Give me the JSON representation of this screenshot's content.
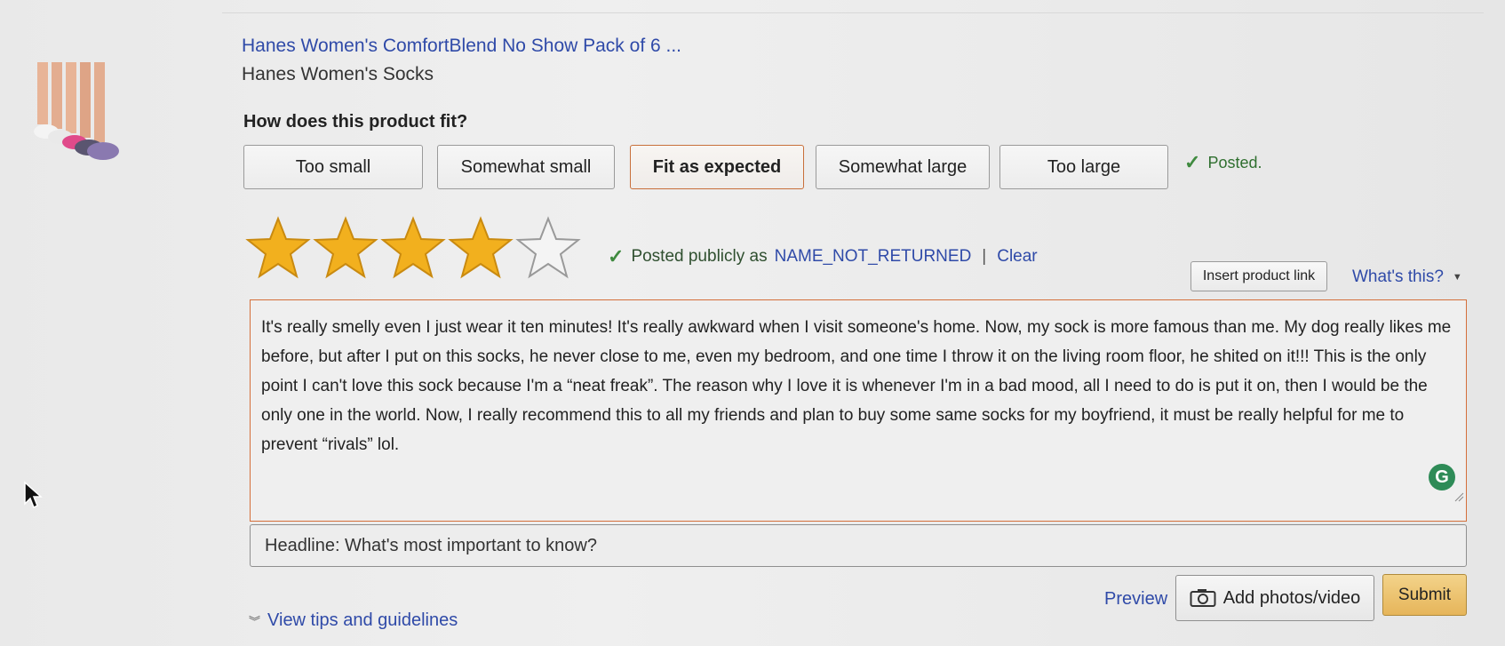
{
  "product": {
    "title": "Hanes Women's ComfortBlend No Show Pack of 6 ...",
    "subtitle": "Hanes Women's Socks"
  },
  "fit": {
    "question": "How does this product fit?",
    "options": [
      "Too small",
      "Somewhat small",
      "Fit as expected",
      "Somewhat large",
      "Too large"
    ],
    "selected": "Fit as expected",
    "status": "Posted."
  },
  "rating": {
    "value": 4,
    "max": 5,
    "star_color": "#f2b01e",
    "posted_prefix": "Posted publicly as",
    "posted_name": "NAME_NOT_RETURNED",
    "separator": "|",
    "clear_label": "Clear"
  },
  "toolbar": {
    "insert_link_label": "Insert product link",
    "whats_this_label": "What's this?"
  },
  "review": {
    "text": "It's really smelly even I just wear it ten minutes! It's really awkward when I visit someone's home. Now, my sock is more famous than me. My dog really likes me before, but after I put on this socks, he never close to me, even my bedroom, and one time I throw it on the living room floor, he shited on it!!! This is the only point I can't love this sock because I'm a “neat freak”. The reason why I love it is whenever I'm in a bad mood, all I need to do is put it on, then I would be the only one in the world. Now, I really recommend this to all my friends and plan to buy some same socks for my boyfriend, it must be really helpful for me to prevent “rivals” lol.",
    "grammarly_letter": "G"
  },
  "headline": {
    "placeholder": "Headline: What's most important to know?"
  },
  "footer": {
    "tips_label": "View tips and guidelines",
    "preview_label": "Preview",
    "add_photos_label": "Add photos/video",
    "submit_label": "Submit"
  },
  "colors": {
    "link": "#2f4aa8",
    "selected_border": "#c86f3a",
    "submit_bg": "#e6b55a",
    "check_green": "#3f8a3f"
  }
}
